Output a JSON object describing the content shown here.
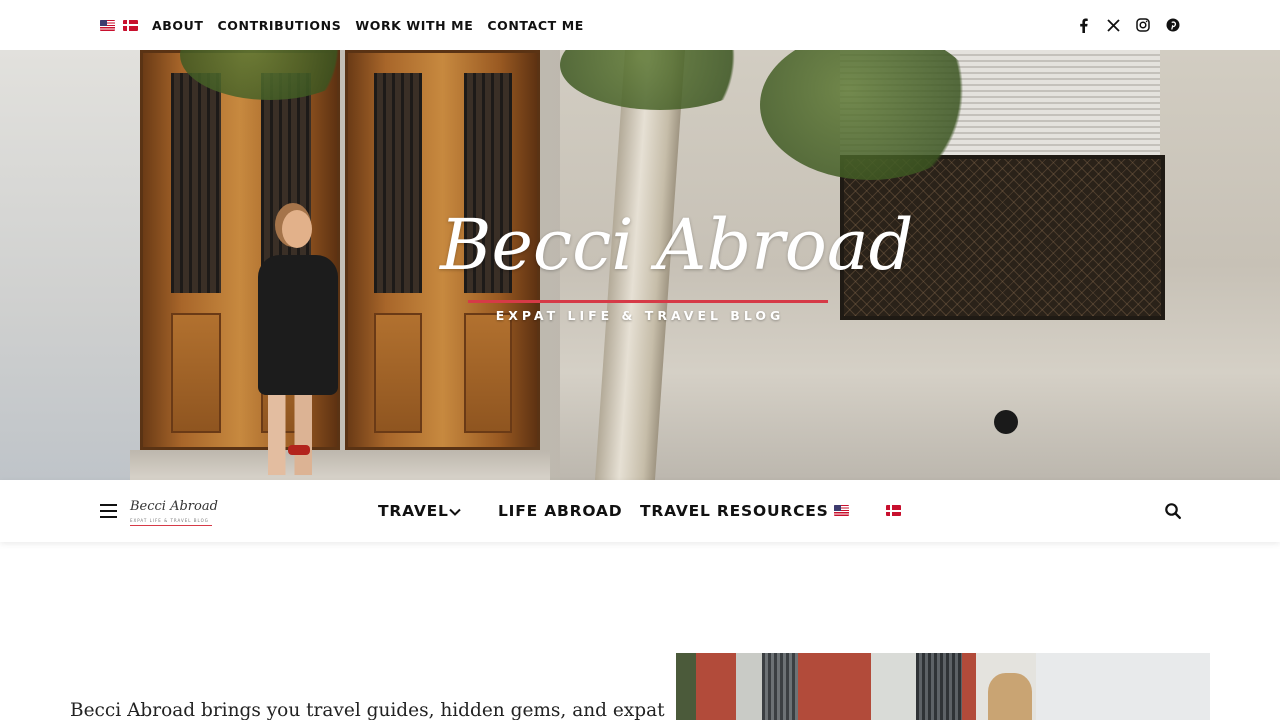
{
  "topbar": {
    "flags": [
      {
        "name": "us-flag-icon",
        "lang": "English"
      },
      {
        "name": "denmark-flag-icon",
        "lang": "Danish"
      }
    ],
    "links": [
      "ABOUT",
      "CONTRIBUTIONS",
      "WORK WITH ME",
      "CONTACT ME"
    ],
    "social_icons": [
      "facebook-icon",
      "x-icon",
      "instagram-icon",
      "pinterest-icon"
    ]
  },
  "hero": {
    "logo_title": "Becci Abroad",
    "logo_tagline": "EXPAT LIFE & TRAVEL BLOG",
    "accent_color": "#d63a47"
  },
  "mainnav": {
    "menu_icon": "hamburger-icon",
    "mini_logo_title": "Becci Abroad",
    "mini_logo_tagline": "EXPAT LIFE & TRAVEL BLOG",
    "items": [
      {
        "label": "TRAVEL",
        "has_dropdown": true
      },
      {
        "label": "LIFE ABROAD",
        "has_dropdown": false
      },
      {
        "label": "TRAVEL RESOURCES",
        "has_dropdown": false
      }
    ],
    "flags": [
      "us-flag-icon",
      "denmark-flag-icon"
    ],
    "search_icon": "search-icon"
  },
  "content": {
    "intro_text": "Becci Abroad brings you travel guides, hidden gems, and expat"
  }
}
